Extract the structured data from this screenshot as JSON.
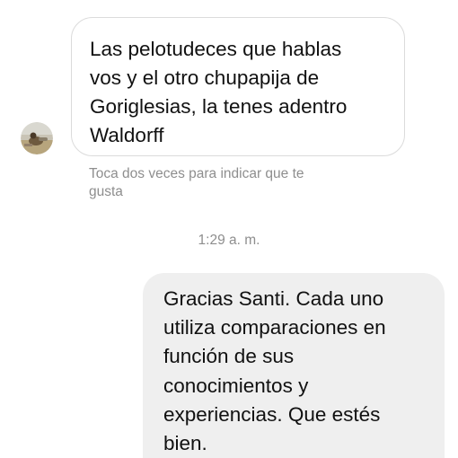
{
  "conversation": {
    "incoming": {
      "text": "Las pelotudeces que hablas\nvos y el otro chupapija de\nGoriglesias, la tenes adentro\nWaldorff",
      "hint": "Toca dos veces para indicar que te\ngusta"
    },
    "timestamp": "1:29 a. m.",
    "outgoing": {
      "text": "Gracias Santi. Cada uno\nutiliza comparaciones en\nfunción de sus\nconocimientos y\nexperiencias. Que estés\nbien."
    }
  },
  "colors": {
    "incoming_border": "#dbdbdb",
    "outgoing_background": "#efefef",
    "meta_text": "#8e8e8e",
    "message_text": "#111111"
  }
}
